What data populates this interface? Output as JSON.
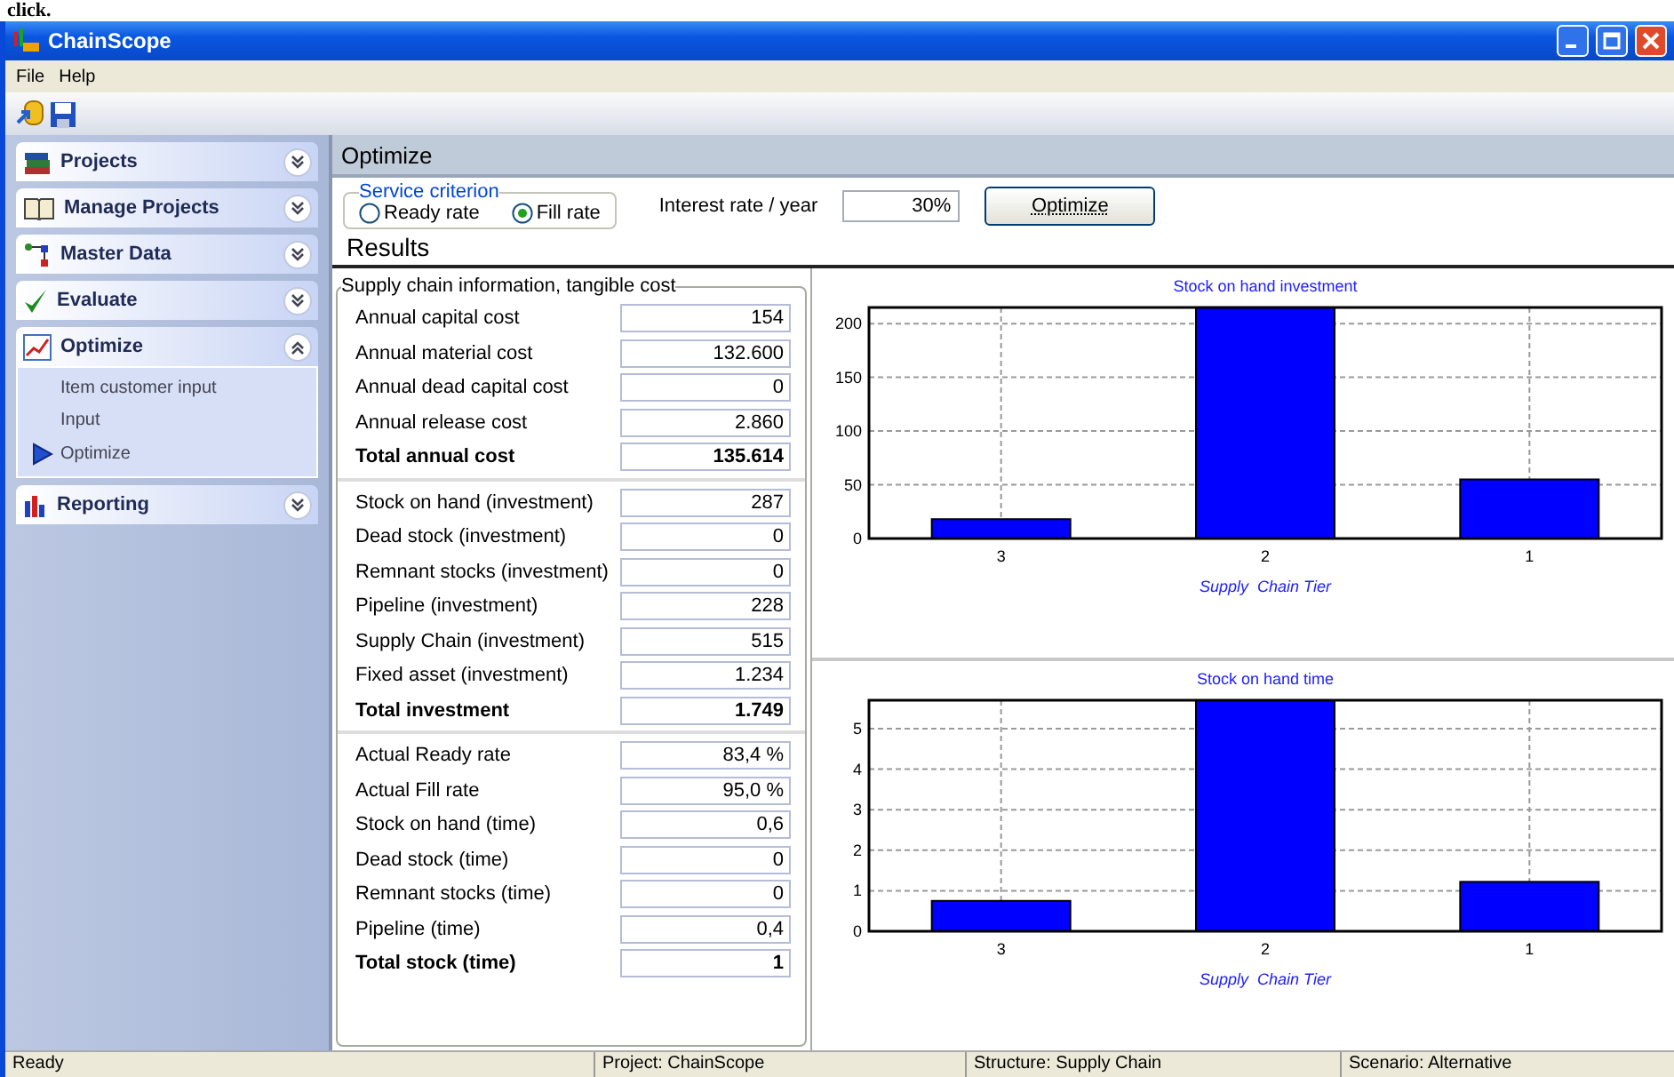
{
  "caption": "click.",
  "window": {
    "title": "ChainScope"
  },
  "menu": [
    "File",
    "Help"
  ],
  "sidebar": {
    "groups": [
      {
        "label": "Projects",
        "expanded": false
      },
      {
        "label": "Manage Projects",
        "expanded": false
      },
      {
        "label": "Master Data",
        "expanded": false
      },
      {
        "label": "Evaluate",
        "expanded": false
      },
      {
        "label": "Optimize",
        "expanded": true,
        "items": [
          {
            "label": "Item customer input",
            "selected": false
          },
          {
            "label": "Input",
            "selected": false
          },
          {
            "label": "Optimize",
            "selected": true
          }
        ]
      },
      {
        "label": "Reporting",
        "expanded": false
      }
    ]
  },
  "page_title": "Optimize",
  "service_criterion": {
    "legend": "Service criterion",
    "options": [
      {
        "label": "Ready rate",
        "selected": false
      },
      {
        "label": "Fill rate",
        "selected": true
      }
    ]
  },
  "interest": {
    "label": "Interest rate / year",
    "value": "30%"
  },
  "optimize_button": "Optimize",
  "results_title": "Results",
  "panel": {
    "legend": "Supply chain information, tangible cost",
    "sections": [
      [
        {
          "label": "Annual capital cost",
          "value": "154",
          "total": false
        },
        {
          "label": "Annual material cost",
          "value": "132.600",
          "total": false
        },
        {
          "label": "Annual dead capital cost",
          "value": "0",
          "total": false
        },
        {
          "label": "Annual release cost",
          "value": "2.860",
          "total": false
        },
        {
          "label": "Total annual cost",
          "value": "135.614",
          "total": true
        }
      ],
      [
        {
          "label": "Stock on hand (investment)",
          "value": "287",
          "total": false
        },
        {
          "label": "Dead stock (investment)",
          "value": "0",
          "total": false
        },
        {
          "label": "Remnant stocks (investment)",
          "value": "0",
          "total": false
        },
        {
          "label": "Pipeline (investment)",
          "value": "228",
          "total": false
        },
        {
          "label": "Supply Chain (investment)",
          "value": "515",
          "total": false
        },
        {
          "label": "Fixed asset (investment)",
          "value": "1.234",
          "total": false
        },
        {
          "label": "Total investment",
          "value": "1.749",
          "total": true
        }
      ],
      [
        {
          "label": "Actual Ready rate",
          "value": "83,4 %",
          "total": false
        },
        {
          "label": "Actual Fill rate",
          "value": "95,0 %",
          "total": false
        },
        {
          "label": "Stock on hand (time)",
          "value": "0,6",
          "total": false
        },
        {
          "label": "Dead stock (time)",
          "value": "0",
          "total": false
        },
        {
          "label": "Remnant stocks (time)",
          "value": "0",
          "total": false
        },
        {
          "label": "Pipeline (time)",
          "value": "0,4",
          "total": false
        },
        {
          "label": "Total stock (time)",
          "value": "1",
          "total": true
        }
      ]
    ]
  },
  "charts": [
    {
      "chart_data": {
        "type": "bar",
        "title": "Stock on hand investment",
        "xlabel": "Supply  Chain Tier",
        "categories": [
          "3",
          "2",
          "1"
        ],
        "series": [
          {
            "color": "#0000ff",
            "values": [
              18,
              215,
              55
            ]
          }
        ],
        "grid": true,
        "ylim": [
          0,
          215
        ],
        "yticks": [
          0,
          50,
          100,
          150,
          200
        ]
      }
    },
    {
      "chart_data": {
        "type": "bar",
        "title": "Stock on hand time",
        "xlabel": "Supply  Chain Tier",
        "categories": [
          "3",
          "2",
          "1"
        ],
        "series": [
          {
            "color": "#0000ff",
            "values": [
              0.75,
              5.7,
              1.22
            ]
          }
        ],
        "grid": true,
        "ylim": [
          0,
          5.7
        ],
        "yticks": [
          0,
          1,
          2,
          3,
          4,
          5
        ]
      }
    }
  ],
  "status_bar": [
    "Ready",
    "Project: ChainScope",
    "Structure: Supply Chain",
    "Scenario: Alternative"
  ]
}
